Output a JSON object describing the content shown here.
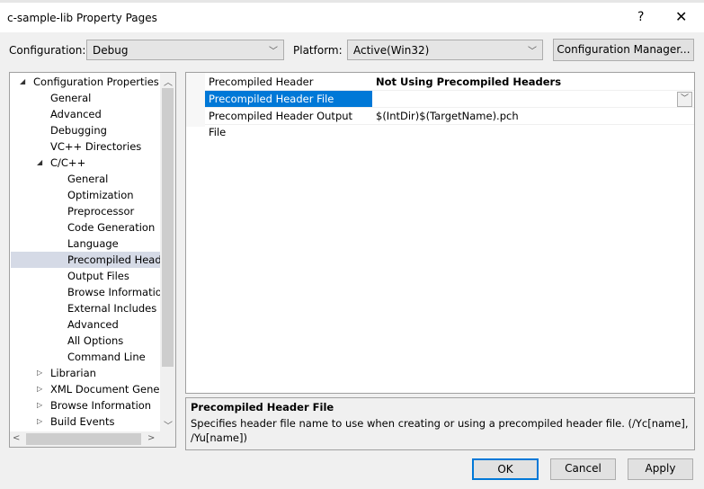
{
  "window": {
    "title": "c-sample-lib Property Pages",
    "help": "?",
    "close": "✕"
  },
  "config": {
    "label": "Configuration:",
    "value": "Debug",
    "platform_label": "Platform:",
    "platform_value": "Active(Win32)",
    "manager_button": "Configuration Manager..."
  },
  "tree": {
    "items": [
      {
        "label": "Configuration Properties",
        "level": 0,
        "arrow": "◢"
      },
      {
        "label": "General",
        "level": 1
      },
      {
        "label": "Advanced",
        "level": 1
      },
      {
        "label": "Debugging",
        "level": 1
      },
      {
        "label": "VC++ Directories",
        "level": 1
      },
      {
        "label": "C/C++",
        "level": 1,
        "arrow": "◢"
      },
      {
        "label": "General",
        "level": 2
      },
      {
        "label": "Optimization",
        "level": 2
      },
      {
        "label": "Preprocessor",
        "level": 2
      },
      {
        "label": "Code Generation",
        "level": 2
      },
      {
        "label": "Language",
        "level": 2
      },
      {
        "label": "Precompiled Headers",
        "level": 2,
        "selected": true
      },
      {
        "label": "Output Files",
        "level": 2
      },
      {
        "label": "Browse Information",
        "level": 2
      },
      {
        "label": "External Includes",
        "level": 2
      },
      {
        "label": "Advanced",
        "level": 2
      },
      {
        "label": "All Options",
        "level": 2
      },
      {
        "label": "Command Line",
        "level": 2
      },
      {
        "label": "Librarian",
        "level": 1,
        "arrow": "▷"
      },
      {
        "label": "XML Document Generator",
        "level": 1,
        "arrow": "▷"
      },
      {
        "label": "Browse Information",
        "level": 1,
        "arrow": "▷"
      },
      {
        "label": "Build Events",
        "level": 1,
        "arrow": "▷"
      }
    ]
  },
  "grid": {
    "rows": [
      {
        "name": "Precompiled Header",
        "value": "Not Using Precompiled Headers",
        "bold": true
      },
      {
        "name": "Precompiled Header File",
        "value": "",
        "selected": true
      },
      {
        "name": "Precompiled Header Output File",
        "value": "$(IntDir)$(TargetName).pch"
      }
    ]
  },
  "description": {
    "title": "Precompiled Header File",
    "text": "Specifies header file name to use when creating or using a precompiled header file. (/Yc[name], /Yu[name])"
  },
  "buttons": {
    "ok": "OK",
    "cancel": "Cancel",
    "apply": "Apply"
  },
  "colors": {
    "selection": "#0078d7",
    "tree_selection": "#d5dae6"
  }
}
